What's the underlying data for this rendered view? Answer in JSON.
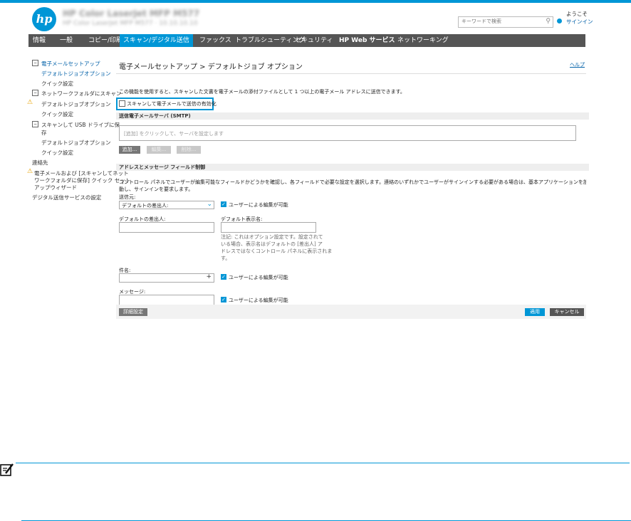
{
  "header": {
    "logo": "hp",
    "printer_name": "HP Color LaserJet MFP M577",
    "printer_subtitle": "HP Color LaserJet MFP M577 · 10.10.10.10",
    "search_placeholder": "キーワードで検索",
    "welcome": "ようこそ",
    "signin": "サインイン"
  },
  "menu": [
    {
      "label": "情報"
    },
    {
      "label": "一般"
    },
    {
      "label": "コピー/印刷"
    },
    {
      "label": "スキャン/デジタル送信"
    },
    {
      "label": "ファックス"
    },
    {
      "label": "トラブルシューティング"
    },
    {
      "label": "セキュリティ"
    },
    {
      "label": "HP Web サービス"
    },
    {
      "label": "ネットワーキング"
    }
  ],
  "sidebar": {
    "email_setup": "電子メールセットアップ",
    "default_job_options": "デフォルトジョブオプション",
    "quick_sets": "クイック設定",
    "network_folder": "ネットワークフォルダにスキャン",
    "nf_default_job_options": "デフォルトジョブオプション",
    "nf_quick_sets": "クイック設定",
    "usb_line1": "スキャンして USB ドライブに保",
    "usb_line2": "存",
    "usb_default_job_options": "デフォルトジョブオプション",
    "usb_quick_sets": "クイック設定",
    "contacts": "連絡先",
    "wizard_line1": "電子メールおよび [スキャンしてネット",
    "wizard_line2": "ワークフォルダに保存] クイック セット",
    "wizard_line3": "アップウィザード",
    "digital_send_settings": "デジタル送信サービスの設定"
  },
  "main": {
    "title": "電子メールセットアップ > デフォルトジョブ オプション",
    "help": "ヘルプ",
    "description": "この機能を使用すると、スキャンした文書を電子メールの添付ファイルとして 1 つ以上の電子メール アドレスに送信できます。",
    "enable_label": "スキャンして電子メールで送信の有効化",
    "smtp_section": "送信電子メールサーバ (SMTP)",
    "smtp_placeholder": "[追加] をクリックして、サーバを設定します",
    "btn_add": "追加...",
    "btn_edit": "編集...",
    "btn_delete": "削除...",
    "field_section": "アドレスとメッセージ フィールド制御",
    "field_desc_1": "コントロール パネルでユーザーが編集可能なフィールドかどうかを確認し、各フィールドで必要な設定を選択します。連絡のいずれかでユーザーがサインインする必要がある場合は、基本アプリケーションを設定して [セキュリティ] タブに移",
    "field_desc_2": "動し、サインインを要求します。",
    "from_label": "送信元:",
    "from_value": "デフォルトの差出人:",
    "user_edit": "ユーザーによる編集が可能",
    "default_from_label": "デフォルトの差出人:",
    "default_display_label": "デフォルト表示名:",
    "note_line1": "注記: これはオプション設定です。設定されて",
    "note_line2": "いる場合、表示名はデフォルトの [差出人] ア",
    "note_line3": "ドレスではなくコントロール パネルに表示されま",
    "note_line4": "す。",
    "subject_label": "件名:",
    "message_label": "メッセージ:",
    "advanced_btn": "詳細設定",
    "apply_btn": "適用",
    "cancel_btn": "キャンセル"
  },
  "colors": {
    "accent": "#0096d6",
    "menubar": "#555555"
  },
  "note_icon": "note-pencil-icon"
}
